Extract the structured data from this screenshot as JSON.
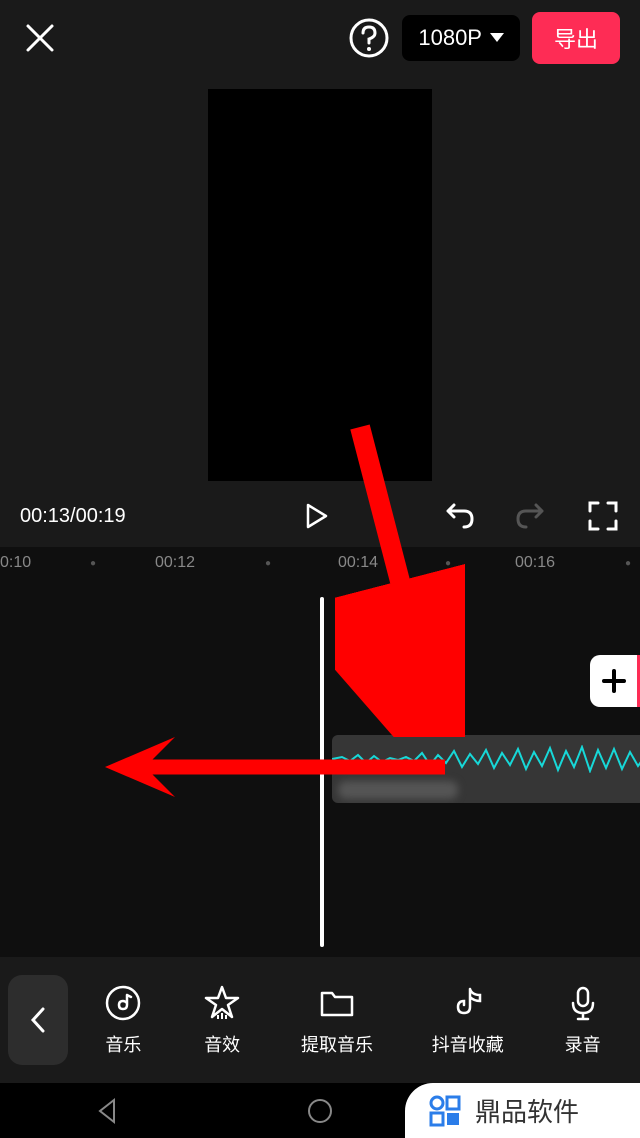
{
  "header": {
    "resolution": "1080P",
    "export_label": "导出"
  },
  "controls": {
    "time_display": "00:13/00:19"
  },
  "timeline": {
    "ruler": [
      "0:10",
      "00:12",
      "00:14",
      "00:16"
    ]
  },
  "toolbar": {
    "items": [
      {
        "label": "音乐",
        "icon": "music-disc-icon"
      },
      {
        "label": "音效",
        "icon": "star-icon"
      },
      {
        "label": "提取音乐",
        "icon": "folder-icon"
      },
      {
        "label": "抖音收藏",
        "icon": "tiktok-icon"
      },
      {
        "label": "录音",
        "icon": "microphone-icon"
      }
    ]
  },
  "watermark": {
    "text": "鼎品软件"
  }
}
